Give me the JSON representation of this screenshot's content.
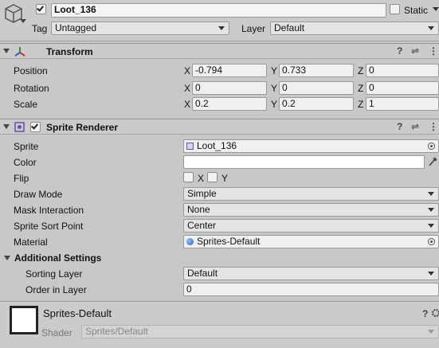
{
  "gameobject": {
    "name": "Loot_136",
    "static_label": "Static",
    "tag_label": "Tag",
    "tag_value": "Untagged",
    "layer_label": "Layer",
    "layer_value": "Default"
  },
  "transform": {
    "title": "Transform",
    "position_label": "Position",
    "rotation_label": "Rotation",
    "scale_label": "Scale",
    "axis_x": "X",
    "axis_y": "Y",
    "axis_z": "Z",
    "position": {
      "x": "-0.794",
      "y": "0.733",
      "z": "0"
    },
    "rotation": {
      "x": "0",
      "y": "0",
      "z": "0"
    },
    "scale": {
      "x": "0.2",
      "y": "0.2",
      "z": "1"
    }
  },
  "sprite_renderer": {
    "title": "Sprite Renderer",
    "sprite_label": "Sprite",
    "sprite_value": "Loot_136",
    "color_label": "Color",
    "color_value": "#ffffff",
    "flip_label": "Flip",
    "flip_x": "X",
    "flip_y": "Y",
    "draw_mode_label": "Draw Mode",
    "draw_mode_value": "Simple",
    "mask_label": "Mask Interaction",
    "mask_value": "None",
    "sort_point_label": "Sprite Sort Point",
    "sort_point_value": "Center",
    "material_label": "Material",
    "material_value": "Sprites-Default",
    "additional_label": "Additional Settings",
    "sorting_layer_label": "Sorting Layer",
    "sorting_layer_value": "Default",
    "order_label": "Order in Layer",
    "order_value": "0"
  },
  "material": {
    "name": "Sprites-Default",
    "shader_label": "Shader",
    "shader_value": "Sprites/Default"
  },
  "icons": {
    "header_help": "?",
    "header_presets": "⇌",
    "header_more": "⋮"
  }
}
